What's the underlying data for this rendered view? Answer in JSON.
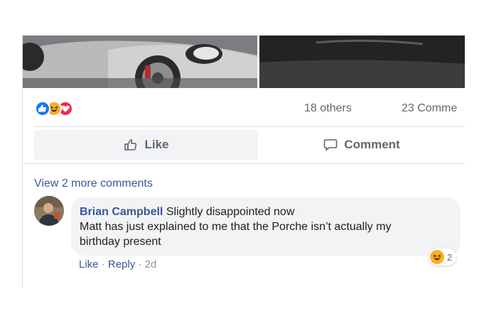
{
  "post": {
    "reactions": [
      "like-icon",
      "haha-icon",
      "love-icon"
    ],
    "others_text": "18 others",
    "comments_count_text": "23 Comme"
  },
  "actions": {
    "like_label": "Like",
    "comment_label": "Comment"
  },
  "comments": {
    "view_more_label": "View 2 more comments",
    "item": {
      "author": "Brian Campbell",
      "text_line1": "Slightly disappointed now",
      "text_line2": "Matt has just explained to me that the Porche isn’t actually my",
      "text_line3": "birthday present",
      "reaction_icon": "haha-icon",
      "reaction_count": "2",
      "like_label": "Like",
      "reply_label": "Reply",
      "separator": "·",
      "time": "2d"
    }
  },
  "colors": {
    "link": "#385898",
    "like_blue": "#1877f2",
    "love_red": "#f0284a",
    "haha_yellow": "#f7b125"
  }
}
